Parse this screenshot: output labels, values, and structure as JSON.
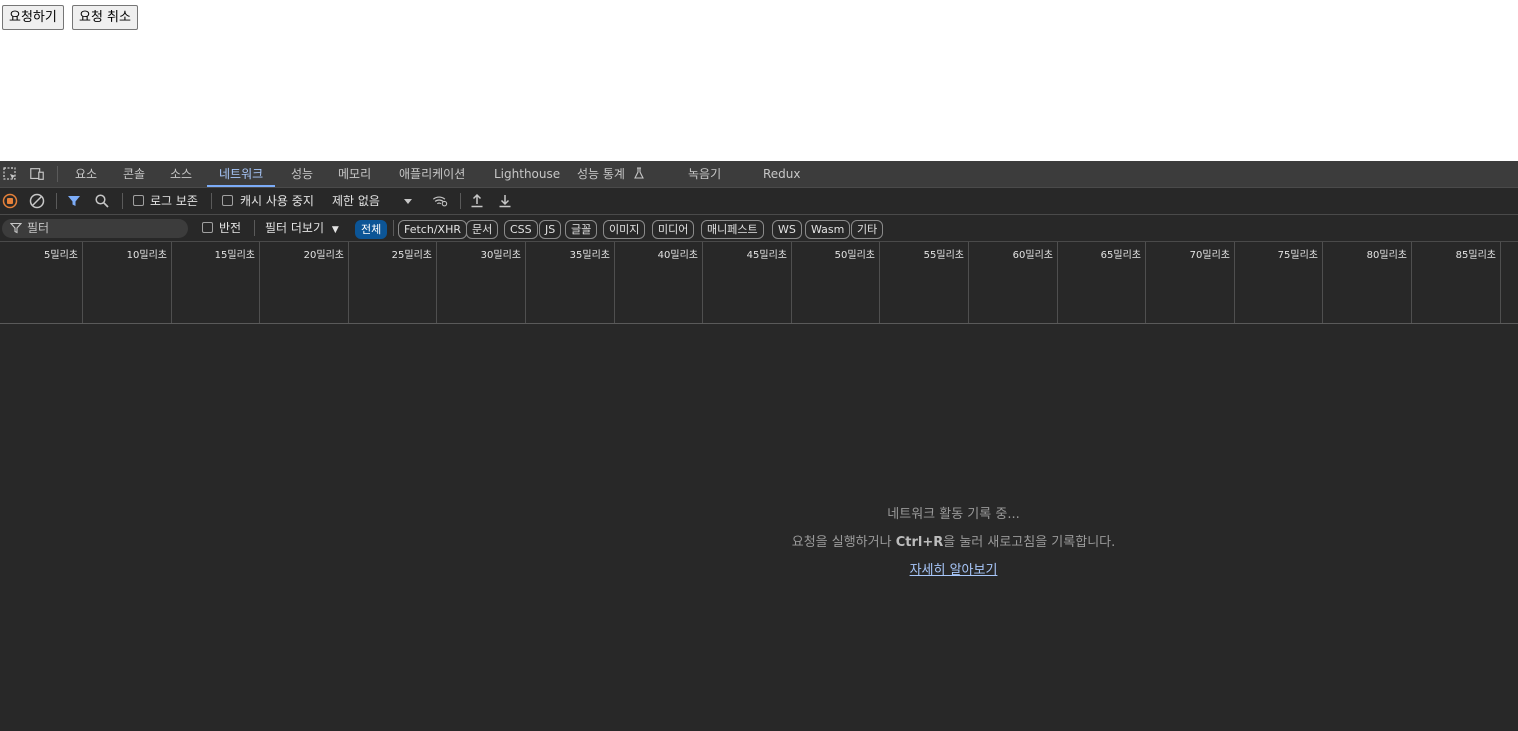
{
  "page": {
    "buttons": [
      "요청하기",
      "요청 취소"
    ]
  },
  "devtools": {
    "tabs": [
      "요소",
      "콘솔",
      "소스",
      "네트워크",
      "성능",
      "메모리",
      "애플리케이션",
      "Lighthouse",
      "성능 통계",
      "녹음기",
      "Redux"
    ],
    "active_tab": "네트워크",
    "toolbar": {
      "preserve_log": "로그 보존",
      "disable_cache": "캐시 사용 중지",
      "throttling": "제한 없음"
    },
    "filter": {
      "placeholder": "필터",
      "invert": "반전",
      "more_filters": "필터 더보기",
      "types": [
        "전체",
        "Fetch/XHR",
        "문서",
        "CSS",
        "JS",
        "글꼴",
        "이미지",
        "미디어",
        "매니페스트",
        "WS",
        "Wasm",
        "기타"
      ],
      "active_type": "전체"
    },
    "timeline": {
      "ticks": [
        "5밀리초",
        "10밀리초",
        "15밀리초",
        "20밀리초",
        "25밀리초",
        "30밀리초",
        "35밀리초",
        "40밀리초",
        "45밀리초",
        "50밀리초",
        "55밀리초",
        "60밀리초",
        "65밀리초",
        "70밀리초",
        "75밀리초",
        "80밀리초",
        "85밀리초"
      ]
    },
    "empty_state": {
      "line1": "네트워크 활동 기록 중...",
      "line2_prefix": "요청을 실행하거나 ",
      "line2_shortcut": "Ctrl+R",
      "line2_suffix": "을 눌러 새로고침을 기록합니다.",
      "link": "자세히 알아보기"
    },
    "colors": {
      "accent": "#7cacf8",
      "record": "#e5813a",
      "active_chip": "#0c5596"
    }
  }
}
